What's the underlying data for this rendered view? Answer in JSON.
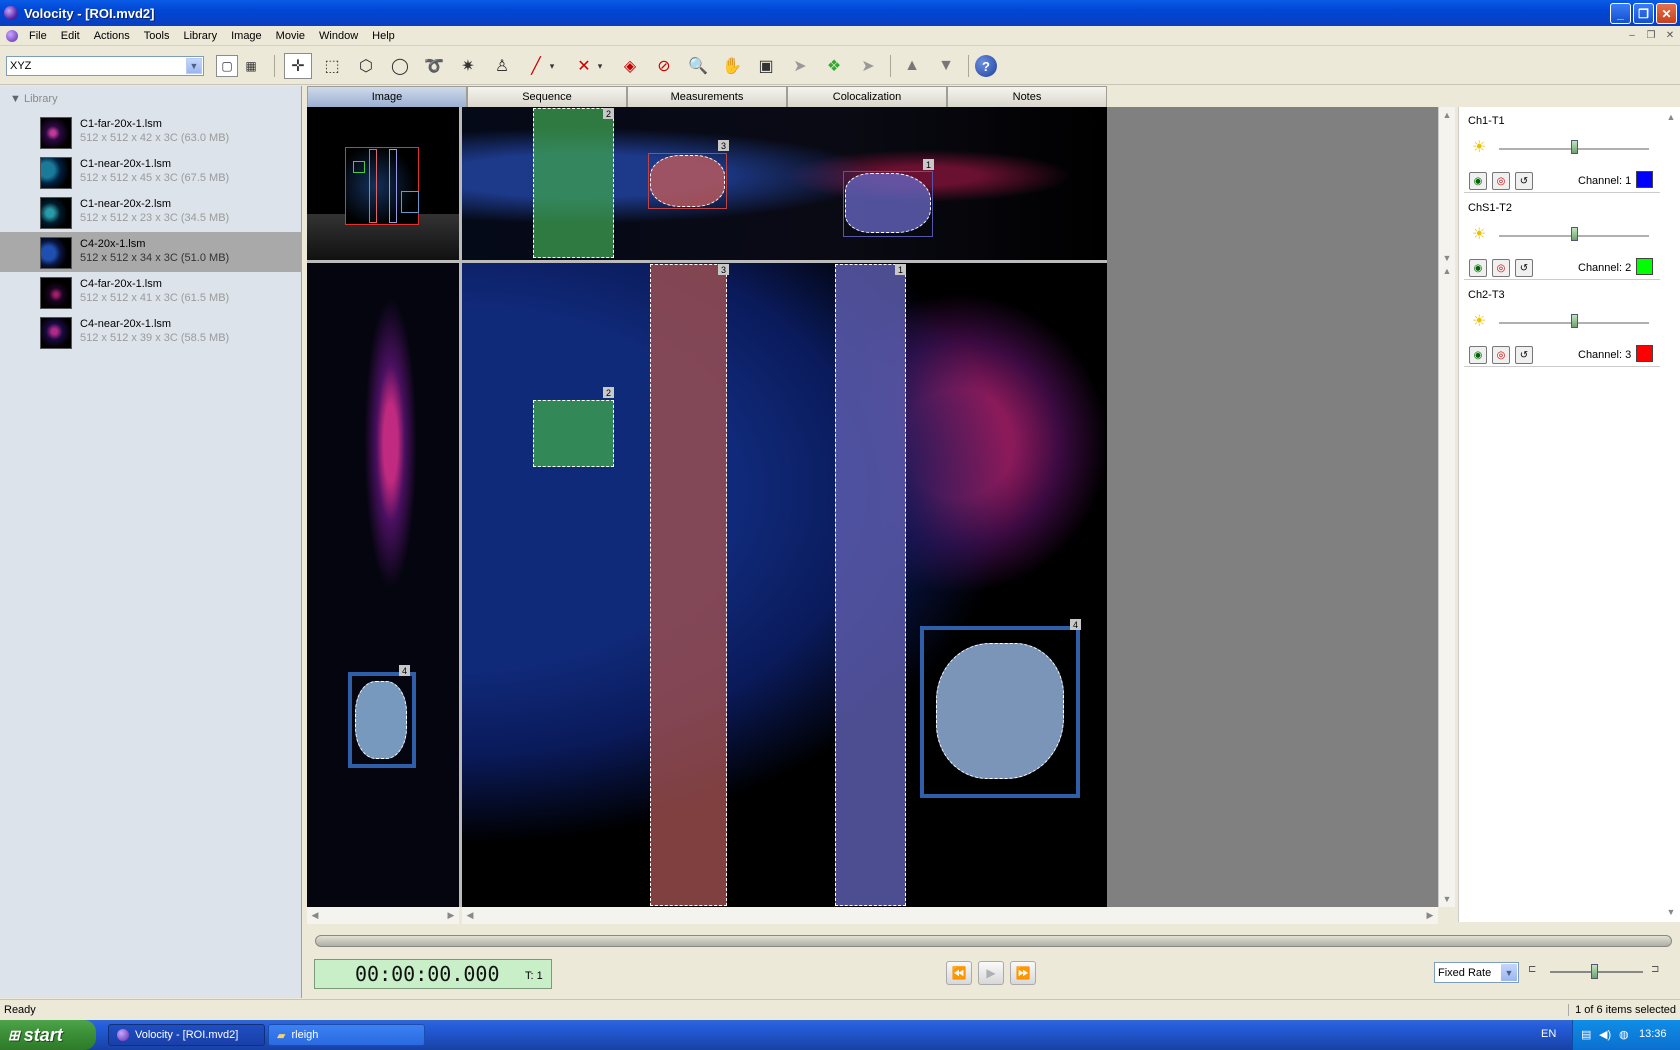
{
  "window": {
    "title": "Volocity - [ROI.mvd2]"
  },
  "menu": [
    "File",
    "Edit",
    "Actions",
    "Tools",
    "Library",
    "Image",
    "Movie",
    "Window",
    "Help"
  ],
  "toolbar": {
    "view_select": "XYZ"
  },
  "library": {
    "header": "Library",
    "items": [
      {
        "name": "C1-far-20x-1.lsm",
        "size": "512 x 512 x 42 x 3C (63.0 MB)"
      },
      {
        "name": "C1-near-20x-1.lsm",
        "size": "512 x 512 x 45 x 3C (67.5 MB)"
      },
      {
        "name": "C1-near-20x-2.lsm",
        "size": "512 x 512 x 23 x 3C (34.5 MB)"
      },
      {
        "name": "C4-20x-1.lsm",
        "size": "512 x 512 x 34 x 3C (51.0 MB)"
      },
      {
        "name": "C4-far-20x-1.lsm",
        "size": "512 x 512 x 41 x 3C (61.5 MB)"
      },
      {
        "name": "C4-near-20x-1.lsm",
        "size": "512 x 512 x 39 x 3C (58.5 MB)"
      }
    ],
    "selected_index": 3
  },
  "tabs": [
    "Image",
    "Sequence",
    "Measurements",
    "Colocalization",
    "Notes"
  ],
  "roi_labels": {
    "r1": "1",
    "r2": "2",
    "r3": "3",
    "r4": "4"
  },
  "channels": [
    {
      "name": "Ch1-T1",
      "label": "Channel: 1",
      "color": "#0000ff",
      "level": 0.5
    },
    {
      "name": "ChS1-T2",
      "label": "Channel: 2",
      "color": "#00ff00",
      "level": 0.5
    },
    {
      "name": "Ch2-T3",
      "label": "Channel: 3",
      "color": "#ff0000",
      "level": 0.5
    }
  ],
  "playback": {
    "timecode": "00:00:00.000",
    "timepoint": "T: 1",
    "rate_mode": "Fixed Rate"
  },
  "status": {
    "left": "Ready",
    "right": "1 of 6 items selected"
  },
  "taskbar": {
    "start": "start",
    "tasks": [
      "Volocity - [ROI.mvd2]",
      "rleigh"
    ],
    "lang": "EN",
    "clock": "13:36"
  }
}
